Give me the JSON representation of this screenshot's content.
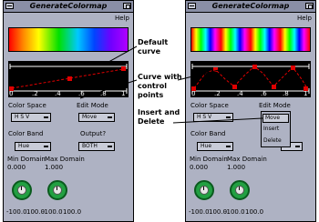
{
  "window": {
    "title": "GenerateColormap",
    "help": "Help"
  },
  "labels": {
    "color_space": "Color Space",
    "edit_mode": "Edit Mode",
    "color_band": "Color Band",
    "output": "Output?",
    "min_domain": "Min Domain",
    "max_domain": "Max Domain"
  },
  "ticks": [
    "0",
    ".2",
    ".4",
    ".6",
    ".8",
    "1"
  ],
  "left": {
    "color_space_value": "H S V",
    "edit_mode_value": "Move",
    "color_band_value": "Hue",
    "output_value": "BOTH",
    "min_domain_value": "0.000",
    "max_domain_value": "1.000",
    "min_range": "-100.0",
    "max_range": "100.0",
    "dial_min_range": "100.0",
    "dial_max_range": "-100.0"
  },
  "right": {
    "color_space_value": "H S V",
    "edit_mode_value": "Move",
    "color_band_value": "Hue",
    "min_domain_value": "0.000",
    "max_domain_value": "1.000",
    "min_range": "-100.0",
    "max_range": "100.0",
    "dial_min_range": "100.0",
    "dial_max_range": "-100.0",
    "edit_menu": [
      "Move",
      "Insert",
      "Delete"
    ]
  },
  "annotations": {
    "default_curve_line1": "Default",
    "default_curve_line2": "curve",
    "control_points_line1": "Curve with",
    "control_points_line2": "control",
    "control_points_line3": "points",
    "insert_delete_line1": "Insert and",
    "insert_delete_line2": "Delete"
  }
}
